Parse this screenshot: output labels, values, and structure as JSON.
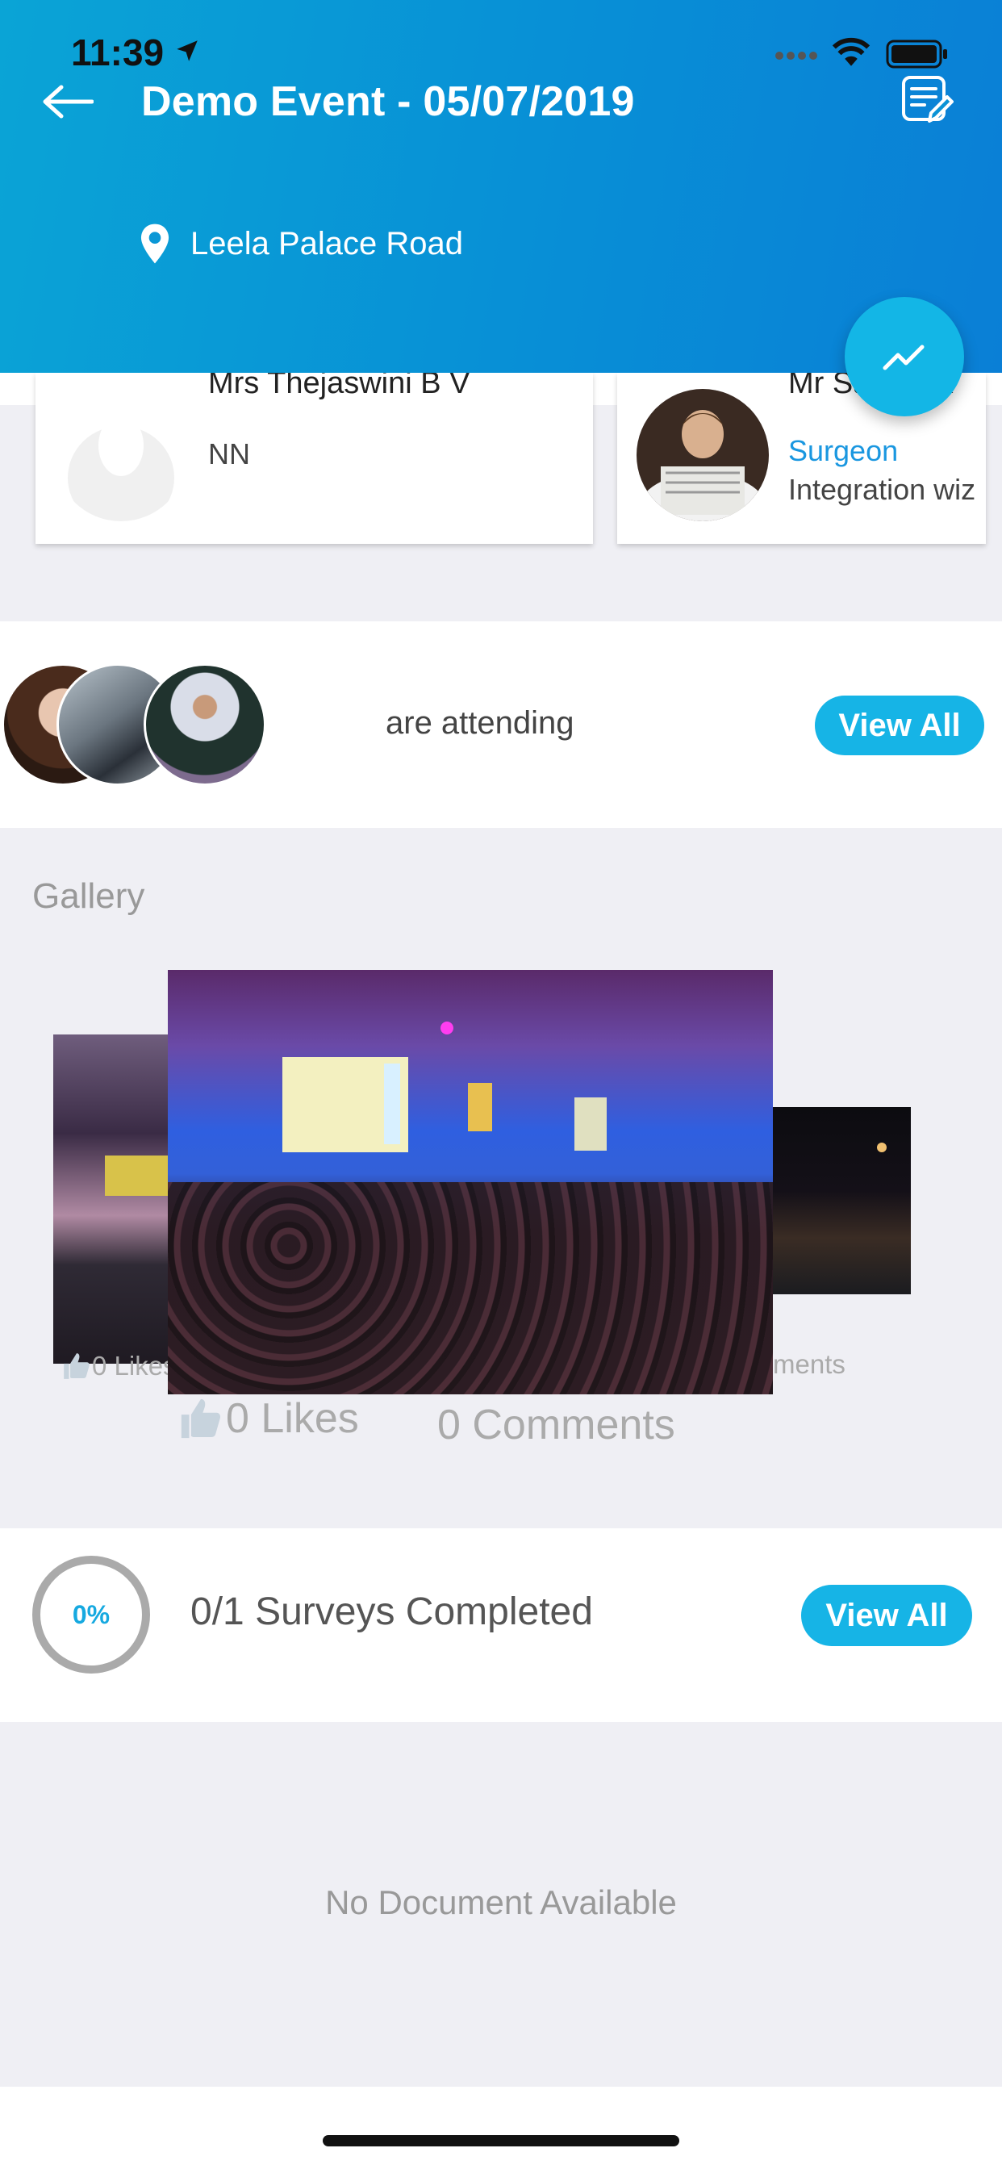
{
  "status_bar": {
    "time": "11:39"
  },
  "header": {
    "title": "Demo Event - 05/07/2019",
    "location": "Leela Palace Road"
  },
  "speakers": [
    {
      "name": "Mrs Thejaswini B V",
      "role": "NN"
    },
    {
      "name": "Mr Sai Rb K",
      "role": "Surgeon",
      "organization": "Integration wiz"
    }
  ],
  "attending": {
    "text": "are attending",
    "button_label": "View All"
  },
  "gallery": {
    "title": "Gallery",
    "side_likes": "0 Likes",
    "side_comments": "ments",
    "likes": "0 Likes",
    "comments": "0 Comments"
  },
  "survey": {
    "progress_label": "0%",
    "progress": 0,
    "text": "0/1 Surveys Completed",
    "button_label": "View All"
  },
  "documents": {
    "empty_text": "No Document Available"
  },
  "colors": {
    "header_blue": "#088fd6",
    "accent": "#16b4e6",
    "link_blue": "#1a97e0"
  }
}
